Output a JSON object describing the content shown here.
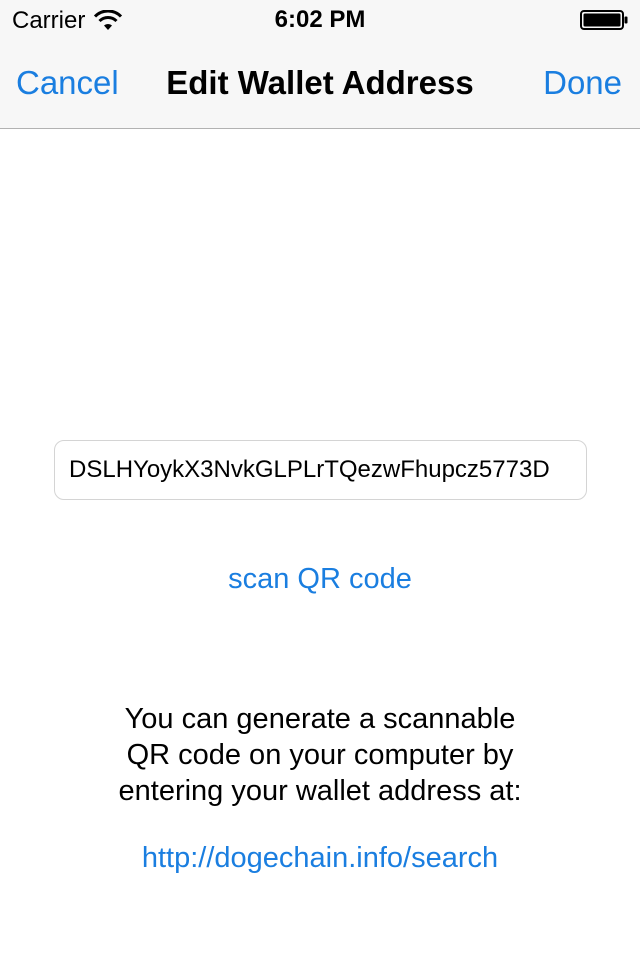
{
  "status_bar": {
    "carrier": "Carrier",
    "time": "6:02 PM",
    "icons": [
      "wifi-icon",
      "battery-icon"
    ]
  },
  "nav": {
    "cancel_label": "Cancel",
    "title": "Edit Wallet Address",
    "done_label": "Done"
  },
  "address": {
    "value": "DSLHYoykX3NvkGLPLrTQezwFhupcz5773D"
  },
  "scan": {
    "label": "scan QR code"
  },
  "info": {
    "line1": "You can generate a scannable",
    "line2": "QR code on your computer by",
    "line3": "entering your wallet address at:",
    "link": "http://dogechain.info/search"
  },
  "colors": {
    "accent": "#1a7ee0",
    "nav_background": "#f7f7f7",
    "text": "#000000"
  }
}
